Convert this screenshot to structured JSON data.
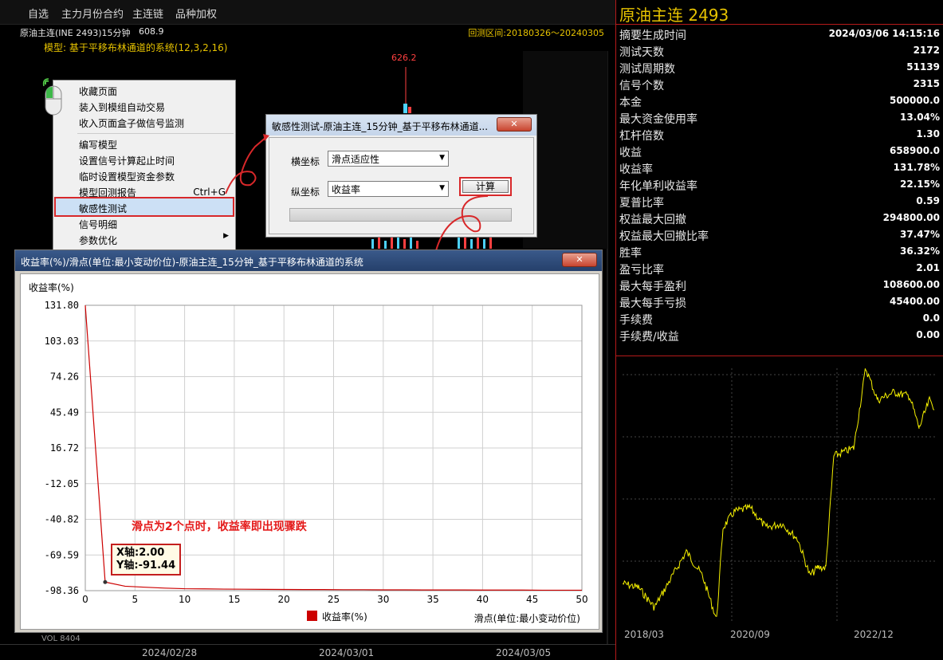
{
  "topbar": {
    "items": [
      "自选",
      "主力月份合约",
      "主连链",
      "品种加权"
    ]
  },
  "chart": {
    "title": "原油主连(INE 2493)15分钟",
    "price": "608.9",
    "range": "回测区间:20180326～20240305",
    "model": "模型: 基于平移布林通道的系统(12,3,2,16)",
    "high": "626.2",
    "vol_label": "VOL 8404",
    "time_axis": [
      "2024/02/28",
      "2024/03/01",
      "2024/03/05"
    ]
  },
  "context_menu": {
    "items": [
      "收藏页面",
      "装入到模组自动交易",
      "收入页面盒子做信号监测",
      "编写模型",
      "设置信号计算起止时间",
      "临时设置模型资金参数",
      "模型回测报告",
      "敏感性测试",
      "信号明细",
      "参数优化"
    ],
    "shortcut": "Ctrl+G"
  },
  "sens_dialog": {
    "title": "敏感性测试-原油主连_15分钟_基于平移布林通道...",
    "x_label": "横坐标",
    "x_value": "滑点适应性",
    "y_label": "纵坐标",
    "y_value": "收益率",
    "calc_label": "计算"
  },
  "result_window": {
    "title": "收益率(%)/滑点(单位:最小变动价位)-原油主连_15分钟_基于平移布林通道的系统",
    "annotation": "滑点为2个点时，收益率即出现骤跌",
    "tooltip_x": "X轴:2.00",
    "tooltip_y": "Y轴:-91.44"
  },
  "chart_data": {
    "type": "line",
    "title": "",
    "ylabel": "收益率(%)",
    "xlabel": "滑点(单位:最小变动价位)",
    "legend": "收益率(%)",
    "legend_position": "bottom-center",
    "grid": true,
    "xlim": [
      0,
      50
    ],
    "ylim": [
      -98.36,
      131.8
    ],
    "y_ticks": [
      "131.80",
      "103.03",
      "74.26",
      "45.49",
      "16.72",
      "-12.05",
      "-40.82",
      "-69.59",
      "-98.36"
    ],
    "x_ticks": [
      "0",
      "5",
      "10",
      "15",
      "20",
      "25",
      "30",
      "35",
      "40",
      "45",
      "50"
    ],
    "series": [
      {
        "name": "收益率(%)",
        "color": "#cc0000",
        "x": [
          0,
          2,
          4,
          6,
          8,
          10,
          12,
          14,
          16,
          18,
          20,
          22,
          24,
          26,
          28,
          30,
          32,
          34,
          36,
          38,
          40,
          42,
          44,
          46,
          48,
          50
        ],
        "y": [
          131.78,
          -91.44,
          -94.8,
          -95.6,
          -96.3,
          -96.8,
          -96.9,
          -97.1,
          -97.2,
          -97.3,
          -97.4,
          -97.5,
          -97.5,
          -97.6,
          -97.6,
          -97.7,
          -97.7,
          -97.8,
          -97.8,
          -97.8,
          -97.9,
          -97.9,
          -97.9,
          -98.0,
          -98.0,
          -98.0
        ]
      }
    ]
  },
  "right_panel": {
    "title": "原油主连 2493",
    "stats": [
      {
        "k": "摘要生成时间",
        "v": "2024/03/06 14:15:16"
      },
      {
        "k": "测试天数",
        "v": "2172"
      },
      {
        "k": "测试周期数",
        "v": "51139"
      },
      {
        "k": "信号个数",
        "v": "2315"
      },
      {
        "k": "本金",
        "v": "500000.0"
      },
      {
        "k": "最大资金使用率",
        "v": "13.04%"
      },
      {
        "k": "杠杆倍数",
        "v": "1.30"
      },
      {
        "k": "收益",
        "v": "658900.0"
      },
      {
        "k": "收益率",
        "v": "131.78%"
      },
      {
        "k": "年化单利收益率",
        "v": "22.15%"
      },
      {
        "k": "夏普比率",
        "v": "0.59"
      },
      {
        "k": "权益最大回撤",
        "v": "294800.00"
      },
      {
        "k": "权益最大回撤比率",
        "v": "37.47%"
      },
      {
        "k": "胜率",
        "v": "36.32%"
      },
      {
        "k": "盈亏比率",
        "v": "2.01"
      },
      {
        "k": "最大每手盈利",
        "v": "108600.00"
      },
      {
        "k": "最大每手亏损",
        "v": "45400.00"
      },
      {
        "k": "手续费",
        "v": "0.0"
      },
      {
        "k": "手续费/收益",
        "v": "0.00"
      }
    ],
    "equity_axis": [
      "2018/03",
      "2020/09",
      "2022/12"
    ]
  },
  "colors": {
    "accent": "#e6c200",
    "border_red": "#b51a1a",
    "series_red": "#cc0000"
  }
}
